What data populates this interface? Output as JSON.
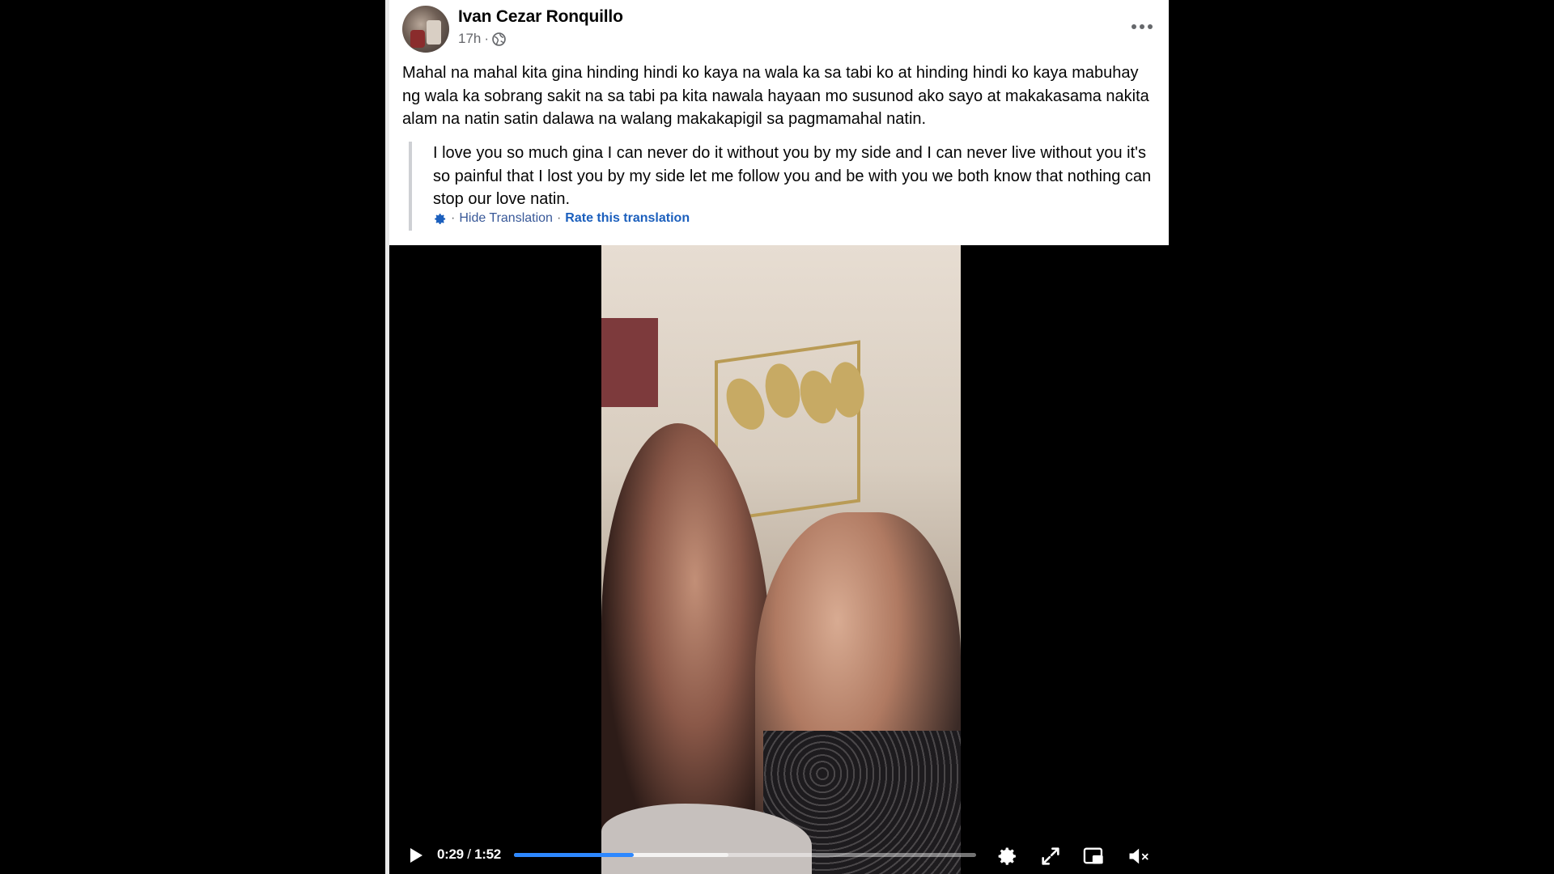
{
  "post": {
    "author": "Ivan Cezar Ronquillo",
    "time": "17h",
    "meta_separator": "·",
    "text": "Mahal na mahal kita gina hinding hindi ko kaya na wala ka sa tabi ko at hinding hindi ko kaya mabuhay ng wala ka sobrang sakit na sa tabi pa kita nawala hayaan mo susunod ako sayo at makakasama nakita alam na natin satin dalawa na walang makakapigil sa pagmamahal natin.",
    "translation": {
      "text": "I love you so much gina I can never do it without you by my side and I can never live without you it's so painful that I lost you by my side let me follow you and be with you we both know that nothing can stop our love natin.",
      "separator": "·",
      "hide_label": "Hide Translation",
      "rate_label": "Rate this translation"
    }
  },
  "video": {
    "current_time": "0:29",
    "time_separator": "/",
    "duration": "1:52",
    "progress_fraction": 0.259,
    "buffered_fraction": 0.464
  },
  "colors": {
    "accent": "#2d88ff",
    "link": "#385898"
  },
  "icons": [
    "globe-icon",
    "more-options-icon",
    "gear-icon",
    "play-icon",
    "settings-icon",
    "fullscreen-icon",
    "picture-in-picture-icon",
    "mute-icon"
  ]
}
